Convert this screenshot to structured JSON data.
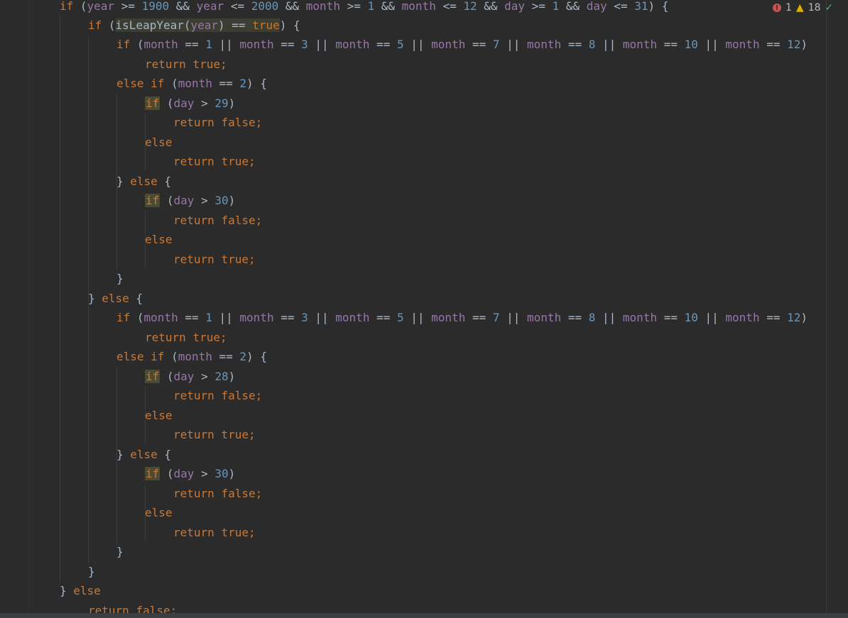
{
  "inspection": {
    "errors": "1",
    "warnings": "18",
    "error_symbol": "!",
    "warning_symbol": "▲",
    "ok_symbol": "✓"
  },
  "code": {
    "l1": [
      "if",
      " (",
      "year",
      " >= ",
      "1900",
      " && ",
      "year",
      " <= ",
      "2000",
      " && ",
      "month",
      " >= ",
      "1",
      " && ",
      "month",
      " <= ",
      "12",
      " && ",
      "day",
      " >= ",
      "1",
      " && ",
      "day",
      " <= ",
      "31",
      ") {"
    ],
    "l2": [
      "if",
      " (",
      "isLeapYear(",
      "year",
      ") == ",
      "true",
      ") {"
    ],
    "l3": [
      "if",
      " (",
      "month",
      " == ",
      "1",
      " || ",
      "month",
      " == ",
      "3",
      " || ",
      "month",
      " == ",
      "5",
      " || ",
      "month",
      " == ",
      "7",
      " || ",
      "month",
      " == ",
      "8",
      " || ",
      "month",
      " == ",
      "10",
      " || ",
      "month",
      " == ",
      "12",
      ")"
    ],
    "l4": [
      "return",
      " ",
      "true",
      ";"
    ],
    "l5": [
      "else",
      " ",
      "if",
      " (",
      "month",
      " == ",
      "2",
      ") {"
    ],
    "l6": [
      "if",
      " (",
      "day",
      " > ",
      "29",
      ")"
    ],
    "l7": [
      "return",
      " ",
      "false",
      ";"
    ],
    "l8": [
      "else"
    ],
    "l9": [
      "return",
      " ",
      "true",
      ";"
    ],
    "l10": [
      "} ",
      "else",
      " {"
    ],
    "l11": [
      "if",
      " (",
      "day",
      " > ",
      "30",
      ")"
    ],
    "l12": [
      "return",
      " ",
      "false",
      ";"
    ],
    "l13": [
      "else"
    ],
    "l14": [
      "return",
      " ",
      "true",
      ";"
    ],
    "l15": [
      "}"
    ],
    "l16": [
      "} ",
      "else",
      " {"
    ],
    "l17": [
      "if",
      " (",
      "month",
      " == ",
      "1",
      " || ",
      "month",
      " == ",
      "3",
      " || ",
      "month",
      " == ",
      "5",
      " || ",
      "month",
      " == ",
      "7",
      " || ",
      "month",
      " == ",
      "8",
      " || ",
      "month",
      " == ",
      "10",
      " || ",
      "month",
      " == ",
      "12",
      ")"
    ],
    "l18": [
      "return",
      " ",
      "true",
      ";"
    ],
    "l19": [
      "else",
      " ",
      "if",
      " (",
      "month",
      " == ",
      "2",
      ") {"
    ],
    "l20": [
      "if",
      " (",
      "day",
      " > ",
      "28",
      ")"
    ],
    "l21": [
      "return",
      " ",
      "false",
      ";"
    ],
    "l22": [
      "else"
    ],
    "l23": [
      "return",
      " ",
      "true",
      ";"
    ],
    "l24": [
      "} ",
      "else",
      " {"
    ],
    "l25": [
      "if",
      " (",
      "day",
      " > ",
      "30",
      ")"
    ],
    "l26": [
      "return",
      " ",
      "false",
      ";"
    ],
    "l27": [
      "else"
    ],
    "l28": [
      "return",
      " ",
      "true",
      ";"
    ],
    "l29": [
      "}"
    ],
    "l30": [
      "}"
    ],
    "l31": [
      "} ",
      "else"
    ],
    "l32": [
      "return",
      " ",
      "false",
      ";"
    ]
  }
}
